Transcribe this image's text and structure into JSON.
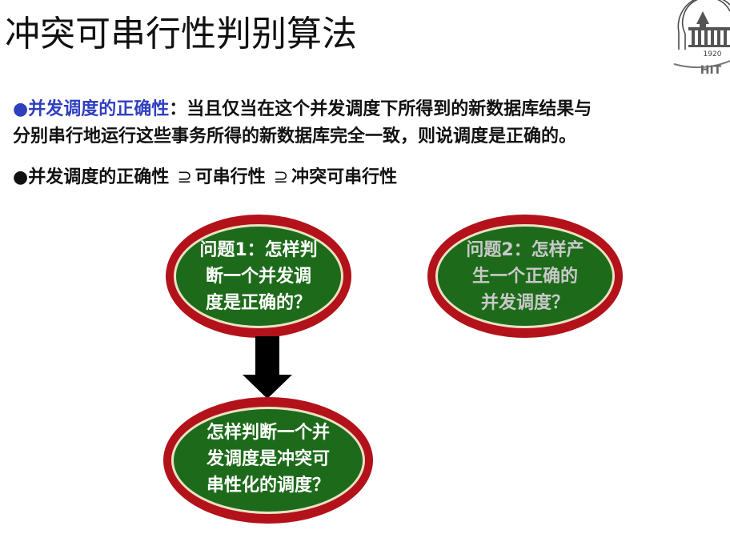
{
  "title": "冲突可串行性判别算法",
  "bullet1": {
    "marker": "●",
    "highlight": "并发调度的正确性",
    "rest_line1": "：当且仅当在这个并发调度下所得到的新数据库结果与",
    "line2": "分别串行地运行这些事务所得的新数据库完全一致，则说调度是正确的。"
  },
  "bullet2": {
    "marker": "●",
    "part1": "并发调度的正确性",
    "symbol": "⊇",
    "part2": "可串行性",
    "part3": "冲突可串行性"
  },
  "question1": "问题1：怎样判\n断一个并发调\n度是正确的？",
  "question2": "问题2：怎样产\n生一个正确的\n并发调度？",
  "question3": "怎样判断一个并\n发调度是冲突可\n串性化的调度？",
  "logo": {
    "year": "1920",
    "letters": "HIT"
  },
  "colors": {
    "oval_border": "#b3121a",
    "oval_fill": "#1d6b1a",
    "highlight": "#2f3fbf"
  }
}
